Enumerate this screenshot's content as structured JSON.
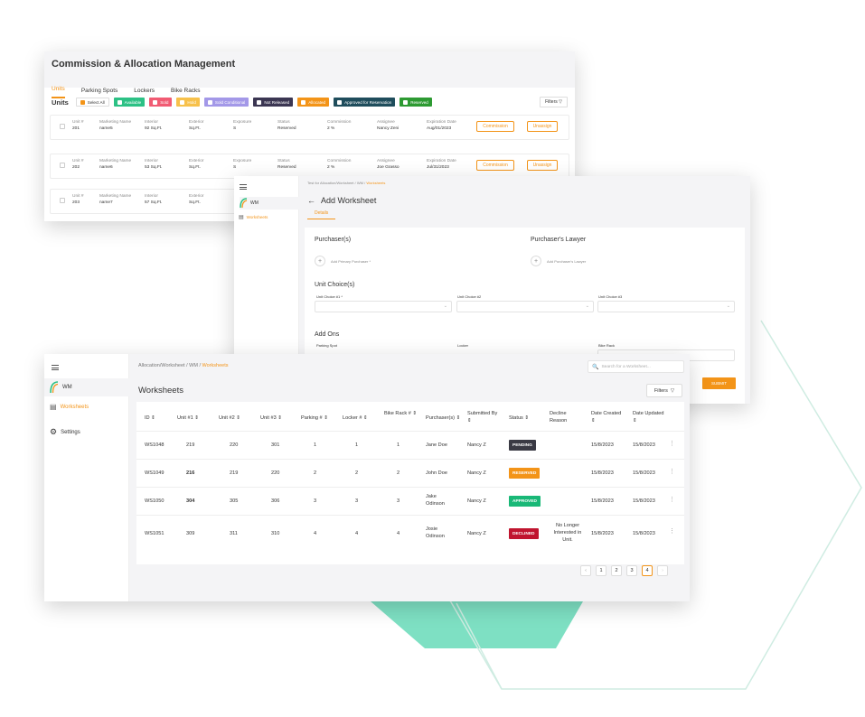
{
  "colors": {
    "accent": "#f39418",
    "decor": "#7ee0c3"
  },
  "commission": {
    "title": "Commission & Allocation Management",
    "tabs": [
      "Units",
      "Parking Spots",
      "Lockers",
      "Bike Racks"
    ],
    "units_label": "Units",
    "select_all": "Select All",
    "statuses": [
      {
        "label": "Available",
        "color": "#2cc185"
      },
      {
        "label": "Sold",
        "color": "#f15b73"
      },
      {
        "label": "Hold",
        "color": "#f7c14b"
      },
      {
        "label": "Sold Conditional",
        "color": "#a398e8"
      },
      {
        "label": "Not Released",
        "color": "#3b3652"
      },
      {
        "label": "Allocated",
        "color": "#f39418"
      },
      {
        "label": "Approved for Reservation",
        "color": "#1f4d5c"
      },
      {
        "label": "Reserved",
        "color": "#2d9a32"
      }
    ],
    "filters": "Filters",
    "field_labels": {
      "unit": "Unit #",
      "marketing": "Marketing Name",
      "interior": "Interior",
      "exterior": "Exterior",
      "exposure": "Exposure",
      "status": "Status",
      "commission": "Commission",
      "assignee": "Assignee",
      "expiration": "Expiration Date"
    },
    "rows": [
      {
        "unit": "201",
        "name": "name5",
        "interior": "92 Sq.Ft.",
        "exterior": "Sq.Ft.",
        "exposure": "S",
        "status": "Reserved",
        "commission": "2 %",
        "assignee": "Nancy Zeni",
        "expiration": "Aug/01/2023"
      },
      {
        "unit": "202",
        "name": "name6",
        "interior": "53 Sq.Ft.",
        "exterior": "Sq.Ft.",
        "exposure": "S",
        "status": "Reserved",
        "commission": "2 %",
        "assignee": "Joe Grasso",
        "expiration": "Jul/31/2023"
      },
      {
        "unit": "203",
        "name": "name7",
        "interior": "57 Sq.Ft.",
        "exterior": "Sq.Ft."
      }
    ],
    "commission_btn": "Commission",
    "unassign_btn": "Unassign"
  },
  "add_ws": {
    "project": "WM",
    "nav_worksheets": "Worksheets",
    "breadcrumb": [
      "Test for Allocation/Worksheet",
      "WM",
      "Worksheets"
    ],
    "title": "Add Worksheet",
    "tab": "Details",
    "purchasers": "Purchaser(s)",
    "lawyer": "Purchaser's Lawyer",
    "add_primary": "Add Primary Purchaser *",
    "add_lawyer": "Add Purchaser's Lawyer",
    "unit_choices": "Unit Choice(s)",
    "uc1": "Unit Choice #1 *",
    "uc2": "Unit Choice #2",
    "uc3": "Unit Choice #3",
    "addons": "Add Ons",
    "parking": "Parking Spot",
    "locker": "Locker",
    "bike": "Bike Rack",
    "submit": "SUBMIT"
  },
  "worksheets": {
    "project": "WM",
    "nav_worksheets": "Worksheets",
    "nav_settings": "Settings",
    "breadcrumb": [
      "Allocation/Worksheet",
      "WM",
      "Worksheets"
    ],
    "search_placeholder": "Search for a Worksheet...",
    "title": "Worksheets",
    "filters": "Filters",
    "columns": [
      "ID",
      "Unit #1",
      "Unit #2",
      "Unit #3",
      "Parking #",
      "Locker #",
      "Bike Rack #",
      "Purchaser(s)",
      "Submitted By",
      "Status",
      "Decline Reason",
      "Date Created",
      "Date Updated"
    ],
    "rows": [
      {
        "id": "WS1048",
        "u1": "219",
        "u2": "220",
        "u3": "301",
        "parking": "1",
        "locker": "1",
        "bike": "1",
        "purchaser": "Jane Doe",
        "by": "Nancy Z",
        "status": "PENDING",
        "status_color": "#3a3a44",
        "reason": "",
        "created": "15/8/2023",
        "updated": "15/8/2023"
      },
      {
        "id": "WS1049",
        "u1": "216",
        "u2": "219",
        "u3": "220",
        "parking": "2",
        "locker": "2",
        "bike": "2",
        "purchaser": "John Doe",
        "by": "Nancy Z",
        "status": "RESERVED",
        "status_color": "#f39418",
        "reason": "",
        "created": "15/8/2023",
        "updated": "15/8/2023"
      },
      {
        "id": "WS1050",
        "u1": "304",
        "u2": "305",
        "u3": "306",
        "parking": "3",
        "locker": "3",
        "bike": "3",
        "purchaser": "Jake Odinson",
        "by": "Nancy Z",
        "status": "APPROVED",
        "status_color": "#19b877",
        "reason": "",
        "created": "15/8/2023",
        "updated": "15/8/2023"
      },
      {
        "id": "WS1051",
        "u1": "309",
        "u2": "311",
        "u3": "310",
        "parking": "4",
        "locker": "4",
        "bike": "4",
        "purchaser": "Josie Odinson",
        "by": "Nancy Z",
        "status": "DECLINED",
        "status_color": "#c0152f",
        "reason": "No Longer Interested in Unit.",
        "created": "15/8/2023",
        "updated": "15/8/2023"
      }
    ],
    "pages": [
      "1",
      "2",
      "3",
      "4"
    ],
    "current_page": "4"
  }
}
